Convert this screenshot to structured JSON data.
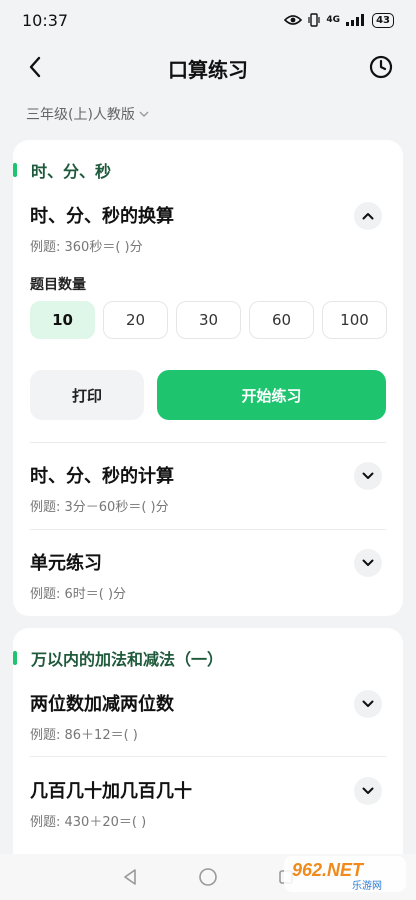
{
  "status_bar": {
    "time": "10:37",
    "network": "4G",
    "battery": "43"
  },
  "header": {
    "title": "口算练习",
    "back_icon": "chevron-left-icon",
    "history_icon": "clock-icon"
  },
  "grade": {
    "label": "三年级(上)人教版"
  },
  "sections": [
    {
      "title": "时、分、秒",
      "topics": [
        {
          "title": "时、分、秒的换算",
          "example": "例题: 360秒＝( )分",
          "expanded": true
        },
        {
          "title": "时、分、秒的计算",
          "example": "例题: 3分－60秒＝( )分",
          "expanded": false
        },
        {
          "title": "单元练习",
          "example": "例题: 6时＝( )分",
          "expanded": false
        }
      ],
      "quantity": {
        "label": "题目数量",
        "options": [
          "10",
          "20",
          "30",
          "60",
          "100"
        ],
        "selected": "10"
      },
      "print_label": "打印",
      "start_label": "开始练习"
    },
    {
      "title": "万以内的加法和减法（一）",
      "topics": [
        {
          "title": "两位数加减两位数",
          "example": "例题: 86＋12＝( )",
          "expanded": false
        },
        {
          "title": "几百几十加几百几十",
          "example": "例题: 430＋20＝( )",
          "expanded": false
        }
      ]
    }
  ],
  "watermark": {
    "brand": "962.NET",
    "sub": "乐游网"
  },
  "colors": {
    "accent": "#1fc46f",
    "selected_bg": "#dff7e8",
    "section_title": "#1f5a3c"
  }
}
